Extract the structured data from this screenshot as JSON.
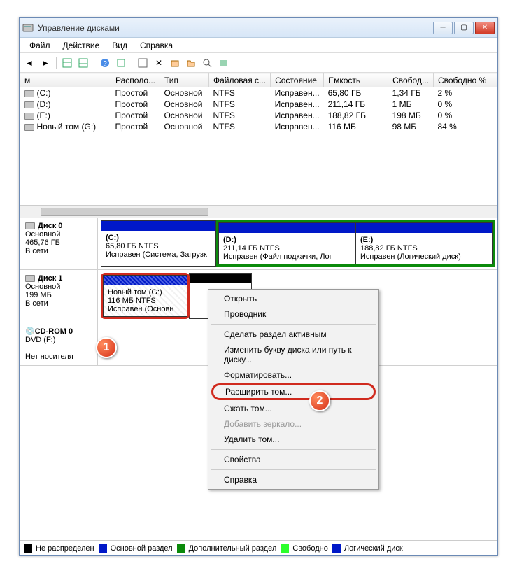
{
  "window": {
    "title": "Управление дисками"
  },
  "menu": {
    "file": "Файл",
    "action": "Действие",
    "view": "Вид",
    "help": "Справка"
  },
  "table": {
    "headers": [
      "м",
      "Располо...",
      "Тип",
      "Файловая с...",
      "Состояние",
      "Емкость",
      "Свобод...",
      "Свободно %"
    ],
    "rows": [
      {
        "name": "(C:)",
        "layout": "Простой",
        "type": "Основной",
        "fs": "NTFS",
        "status": "Исправен...",
        "cap": "65,80 ГБ",
        "free": "1,34 ГБ",
        "pct": "2 %"
      },
      {
        "name": "(D:)",
        "layout": "Простой",
        "type": "Основной",
        "fs": "NTFS",
        "status": "Исправен...",
        "cap": "211,14 ГБ",
        "free": "1 МБ",
        "pct": "0 %"
      },
      {
        "name": "(E:)",
        "layout": "Простой",
        "type": "Основной",
        "fs": "NTFS",
        "status": "Исправен...",
        "cap": "188,82 ГБ",
        "free": "198 МБ",
        "pct": "0 %"
      },
      {
        "name": "Новый том  (G:)",
        "layout": "Простой",
        "type": "Основной",
        "fs": "NTFS",
        "status": "Исправен...",
        "cap": "116 МБ",
        "free": "98 МБ",
        "pct": "84 %"
      }
    ]
  },
  "disk0": {
    "name": "Диск 0",
    "type": "Основной",
    "size": "465,76 ГБ",
    "status": "В сети",
    "c": {
      "label": "(C:)",
      "info": "65,80 ГБ NTFS",
      "status": "Исправен (Система, Загрузк"
    },
    "d": {
      "label": "(D:)",
      "info": "211,14 ГБ NTFS",
      "status": "Исправен (Файл подкачки, Лог"
    },
    "e": {
      "label": "(E:)",
      "info": "188,82 ГБ NTFS",
      "status": "Исправен (Логический диск)"
    }
  },
  "disk1": {
    "name": "Диск 1",
    "type": "Основной",
    "size": "199 МБ",
    "status": "В сети",
    "g": {
      "label": "Новый том  (G:)",
      "info": "116 МБ NTFS",
      "status": "Исправен (Основн"
    }
  },
  "cdrom": {
    "name": "CD-ROM 0",
    "sub": "DVD (F:)",
    "empty": "Нет носителя"
  },
  "ctx": {
    "open": "Открыть",
    "explorer": "Проводник",
    "active": "Сделать раздел активным",
    "letter": "Изменить букву диска или путь к диску...",
    "format": "Форматировать...",
    "extend": "Расширить том...",
    "shrink": "Сжать том...",
    "mirror": "Добавить зеркало...",
    "delete": "Удалить том...",
    "props": "Свойства",
    "help": "Справка"
  },
  "legend": {
    "unalloc": "Не распределен",
    "primary": "Основной раздел",
    "extended": "Дополнительный раздел",
    "free": "Свободно",
    "logical": "Логический диск"
  },
  "badges": {
    "b1": "1",
    "b2": "2"
  }
}
